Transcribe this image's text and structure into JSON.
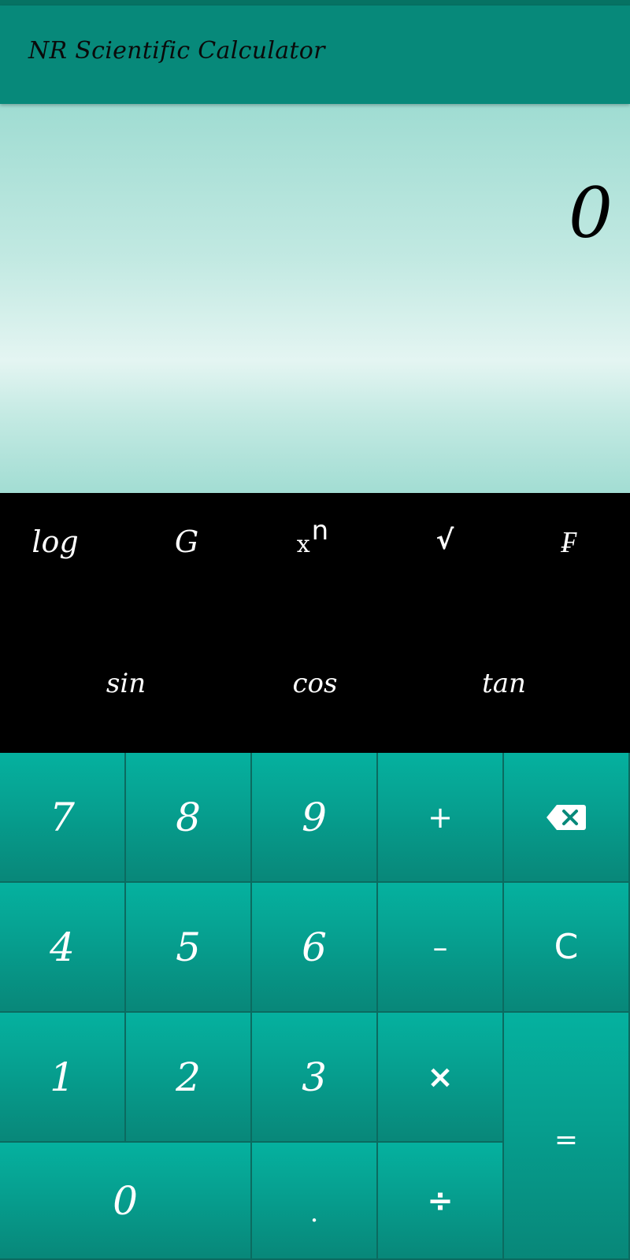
{
  "app": {
    "title": "NR Scientific Calculator"
  },
  "display": {
    "value": "0"
  },
  "scientific": {
    "row1": [
      {
        "id": "log",
        "label": "log"
      },
      {
        "id": "g",
        "label": "G"
      },
      {
        "id": "power",
        "base": "x",
        "exp": "n"
      },
      {
        "id": "sqrt",
        "label": "√"
      },
      {
        "id": "f",
        "label": "₣"
      }
    ],
    "row2": [
      {
        "id": "sin",
        "label": "sin"
      },
      {
        "id": "cos",
        "label": "cos"
      },
      {
        "id": "tan",
        "label": "tan"
      }
    ]
  },
  "keypad": {
    "seven": "7",
    "eight": "8",
    "nine": "9",
    "plus": "+",
    "backspace_icon": "backspace-icon",
    "four": "4",
    "five": "5",
    "six": "6",
    "minus": "–",
    "clear": "C",
    "one": "1",
    "two": "2",
    "three": "3",
    "multiply": "×",
    "equals": "=",
    "zero": "0",
    "dot": ".",
    "divide": "÷"
  },
  "colors": {
    "appbar": "#07897a",
    "key_top": "#05b19f",
    "key_bottom": "#088779",
    "display_light": "#e4f5f2",
    "display_edge": "#9fdcd2"
  }
}
